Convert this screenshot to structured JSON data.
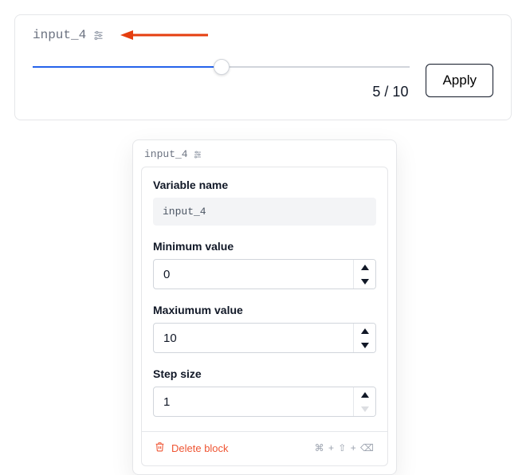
{
  "card": {
    "variable_name": "input_4",
    "slider": {
      "value": 5,
      "max": 10,
      "readout": "5 / 10"
    },
    "apply_label": "Apply"
  },
  "popover": {
    "header_varname": "input_4",
    "bg_readout": "5 / 10",
    "fields": {
      "variable_name_label": "Variable name",
      "variable_name_value": "input_4",
      "min_label": "Minimum value",
      "min_value": "0",
      "max_label": "Maxiumum value",
      "max_value": "10",
      "step_label": "Step size",
      "step_value": "1"
    },
    "delete_label": "Delete block",
    "shortcut": "⌘ + ⇧ + ⌫"
  },
  "icons": {
    "sliders": "sliders-icon",
    "trash": "trash-icon"
  }
}
